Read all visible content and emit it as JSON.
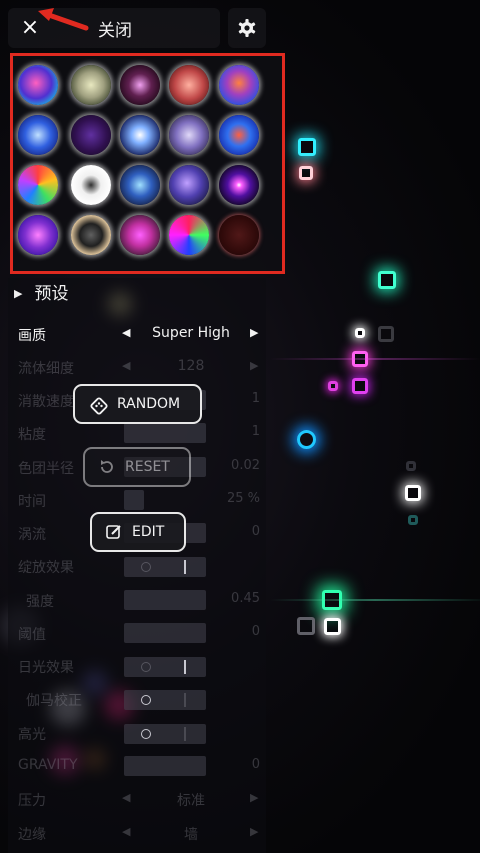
{
  "topbar": {
    "close_icon": "×",
    "close_label": "关闭",
    "settings_icon": "gear-icon"
  },
  "annotations": {
    "arrow_color": "#e02a20",
    "highlight_color": "#e02a20"
  },
  "presets": {
    "label": "预设",
    "expand_icon": "▶",
    "count": 20
  },
  "settings": [
    {
      "label": "画质",
      "type": "select",
      "value": "Super High",
      "dim": false
    },
    {
      "label": "流体细度",
      "type": "select",
      "value": "128",
      "dim": true
    },
    {
      "label": "消散速度",
      "type": "slider",
      "value": "1",
      "dim": true
    },
    {
      "label": "粘度",
      "type": "slider",
      "value": "1",
      "dim": true
    },
    {
      "label": "色团半径",
      "type": "slider",
      "value": "0.02",
      "dim": true
    },
    {
      "label": "时间",
      "type": "slider",
      "value": "25 %",
      "dim": true
    },
    {
      "label": "涡流",
      "type": "slider",
      "value": "0",
      "dim": true
    },
    {
      "label": "绽放效果",
      "type": "toggle",
      "value": "",
      "dim": true
    },
    {
      "label": "强度",
      "type": "slider",
      "value": "0.45",
      "dim": true
    },
    {
      "label": "阈值",
      "type": "slider",
      "value": "0",
      "dim": true
    },
    {
      "label": "日光效果",
      "type": "toggle",
      "value": "",
      "dim": true
    },
    {
      "label": "伽马校正",
      "type": "toggle",
      "value": "",
      "dim": true
    },
    {
      "label": "高光",
      "type": "toggle",
      "value": "",
      "dim": true
    },
    {
      "label": "GRAVITY",
      "type": "slider",
      "value": "0",
      "dim": true
    },
    {
      "label": "压力",
      "type": "select",
      "value": "标准",
      "dim": true
    },
    {
      "label": "边缘",
      "type": "select",
      "value": "墙",
      "dim": true
    }
  ],
  "buttons": {
    "random": "RANDOM",
    "reset": "RESET",
    "edit": "EDIT"
  }
}
